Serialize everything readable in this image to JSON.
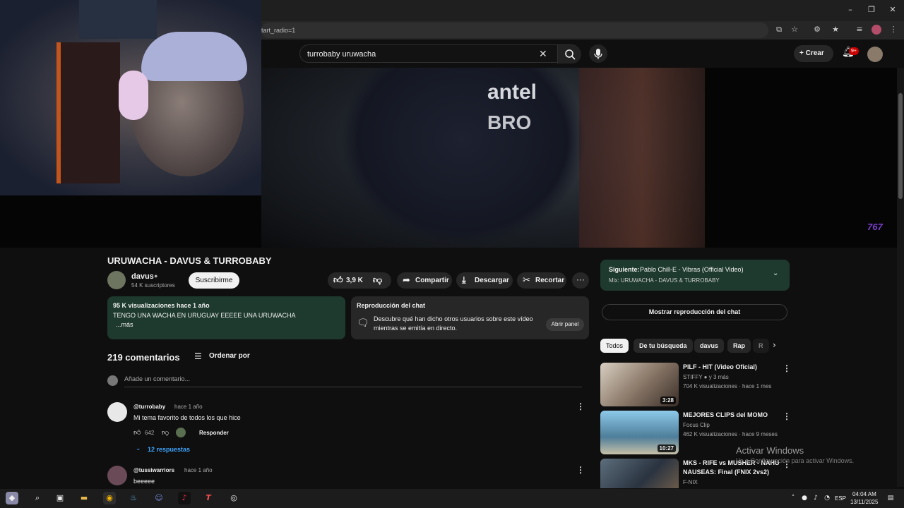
{
  "browser": {
    "url_fragment": "tart_radio=1"
  },
  "youtube_header": {
    "search_query": "turrobaby uruwacha",
    "create_label": "Crear",
    "notifications_badge": "9+"
  },
  "video": {
    "watermark": "767"
  },
  "meta": {
    "title": "URUWACHA - DAVUS & TURROBABY",
    "channel_name": "davus",
    "subscribers": "54 K suscriptores",
    "subscribe_label": "Suscribirme",
    "likes": "3,9 K",
    "share_label": "Compartir",
    "download_label": "Descargar",
    "clip_label": "Recortar"
  },
  "description": {
    "views_date": "95 K visualizaciones  hace 1 año",
    "body": "TENGO UNA WACHA EN URUGUAY EEEEE UNA URUWACHA",
    "more": "...más"
  },
  "chat_replay": {
    "title": "Reproducción del chat",
    "description": "Descubre qué han dicho otros usuarios sobre este vídeo mientras se emitía en directo.",
    "open_label": "Abrir panel"
  },
  "comments": {
    "count_label": "219 comentarios",
    "sort_label": "Ordenar por",
    "add_placeholder": "Añade un comentario...",
    "items": [
      {
        "author": "@turrobaby",
        "time": "hace 1 año",
        "text": "Mi tema favorito de todos los que hice",
        "likes": "642",
        "reply_label": "Responder",
        "replies_label": "12 respuestas"
      },
      {
        "author": "@tussiwarriors",
        "time": "hace 1 año",
        "text": "beeeee"
      }
    ]
  },
  "up_next": {
    "label": "Siguiente:",
    "title": "Pablo Chill-E - Vibras (Official Video)",
    "mix": "Mix: URUWACHA - DAVUS & TURROBABY",
    "show_chat_label": "Mostrar reproducción del chat"
  },
  "chips": [
    "Todos",
    "De tu búsqueda",
    "davus",
    "Rap",
    "R"
  ],
  "related": [
    {
      "title": "PILF - HIT (Video Oficial)",
      "channel": "STIFFY",
      "channel_extra": "y 3 más",
      "meta": "704 K visualizaciones · hace 1 mes",
      "duration": "3:28"
    },
    {
      "title": "MEJORES CLIPS del MOMO",
      "channel": "Focus Clip",
      "meta": "462 K visualizaciones · hace 9 meses",
      "duration": "10:27"
    },
    {
      "title": "MKS - RIFE vs MUSHER - NAHU NAUSEAS: Final (FNIX 2vs2)",
      "channel": "F-NIX"
    }
  ],
  "windows_watermark": {
    "line1": "Activar Windows",
    "line2": "Ve a Configuración para activar Windows."
  },
  "taskbar": {
    "lang": "ESP",
    "time": "04:04 AM",
    "date": "13/11/2025"
  },
  "colors": {
    "description_bg": "#1e3a2e",
    "background": "#0f0f0f",
    "accent_red": "#cc0000"
  }
}
